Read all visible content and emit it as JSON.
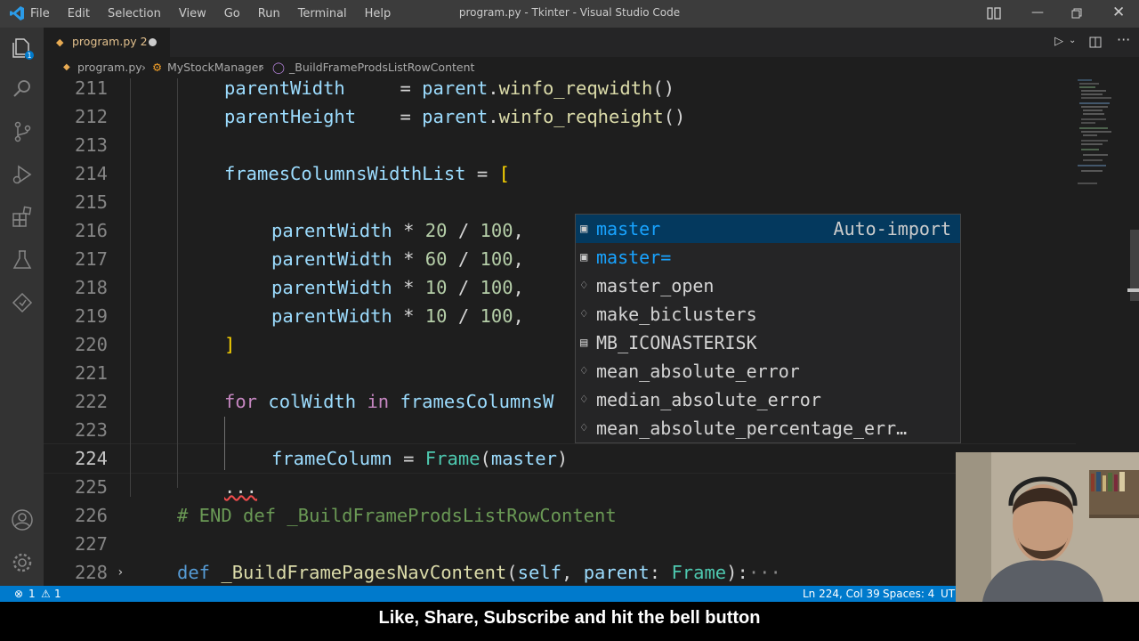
{
  "window": {
    "title": "program.py - Tkinter - Visual Studio Code",
    "menu": [
      "File",
      "Edit",
      "Selection",
      "View",
      "Go",
      "Run",
      "Terminal",
      "Help"
    ]
  },
  "tab": {
    "label": "program.py 2"
  },
  "breadcrumbs": [
    "program.py",
    "MyStockManager",
    "_BuildFrameProdsListRowContent"
  ],
  "editor": {
    "lines": [
      {
        "num": "211",
        "text": "parentWidth     = parent.winfo_reqwidth()"
      },
      {
        "num": "212",
        "text": "parentHeight    = parent.winfo_reqheight()"
      },
      {
        "num": "213",
        "text": ""
      },
      {
        "num": "214",
        "text": "framesColumnsWidthList = ["
      },
      {
        "num": "215",
        "text": ""
      },
      {
        "num": "216",
        "text": "parentWidth * 20 / 100,"
      },
      {
        "num": "217",
        "text": "parentWidth * 60 / 100,"
      },
      {
        "num": "218",
        "text": "parentWidth * 10 / 100,"
      },
      {
        "num": "219",
        "text": "parentWidth * 10 / 100,"
      },
      {
        "num": "220",
        "text": "]"
      },
      {
        "num": "221",
        "text": ""
      },
      {
        "num": "222",
        "text": "for colWidth in framesColumnsW"
      },
      {
        "num": "223",
        "text": ""
      },
      {
        "num": "224",
        "text": "frameColumn = Frame(master)"
      },
      {
        "num": "225",
        "text": "..."
      },
      {
        "num": "226",
        "text": "# END def _BuildFrameProdsListRowContent"
      },
      {
        "num": "227",
        "text": ""
      },
      {
        "num": "228",
        "text": "def _BuildFramePagesNavContent(self, parent: Frame):···"
      }
    ]
  },
  "suggestions": {
    "items": [
      {
        "label": "master",
        "detail": "Auto-import"
      },
      {
        "label": "master="
      },
      {
        "label": "master_open"
      },
      {
        "label": "make_biclusters"
      },
      {
        "label": "MB_ICONASTERISK"
      },
      {
        "label": "mean_absolute_error"
      },
      {
        "label": "median_absolute_error"
      },
      {
        "label": "mean_absolute_percentage_err…"
      }
    ]
  },
  "status": {
    "errors": "1",
    "warnings": "1",
    "position": "Ln 224, Col 39",
    "spaces": "Spaces: 4",
    "encoding": "UTF"
  },
  "caption": "Like, Share, Subscribe and hit the bell button",
  "colors": {
    "accent": "#007acc",
    "selection": "#04395e",
    "match": "#18a3ff"
  }
}
